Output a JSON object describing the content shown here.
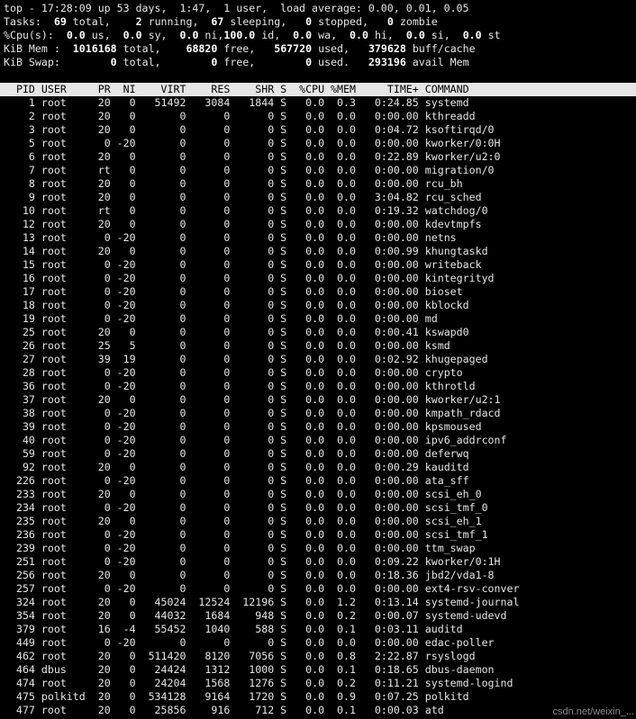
{
  "summary": {
    "top_line": "top - 17:28:09 up 53 days,  1:47,  1 user,  load average: 0.00, 0.01, 0.05",
    "tasks": {
      "prefix": "Tasks:",
      "total": "69",
      "total_l": " total,",
      "running": "2",
      "running_l": " running,",
      "sleeping": "67",
      "sleeping_l": " sleeping,",
      "stopped": "0",
      "stopped_l": " stopped,",
      "zombie": "0",
      "zombie_l": " zombie"
    },
    "cpu": {
      "prefix": "%Cpu(s):",
      "us": "0.0",
      "us_l": " us,",
      "sy": "0.0",
      "sy_l": " sy,",
      "ni": "0.0",
      "ni_l": " ni,",
      "id": "100.0",
      "id_l": " id,",
      "wa": "0.0",
      "wa_l": " wa,",
      "hi": "0.0",
      "hi_l": " hi,",
      "si": "0.0",
      "si_l": " si,",
      "st": "0.0",
      "st_l": " st"
    },
    "mem": {
      "prefix": "KiB Mem :",
      "total": "1016168",
      "total_l": " total,",
      "free": "68820",
      "free_l": " free,",
      "used": "567720",
      "used_l": " used,",
      "cache": "379628",
      "cache_l": " buff/cache"
    },
    "swap": {
      "prefix": "KiB Swap:",
      "total": "0",
      "total_l": " total,",
      "free": "0",
      "free_l": " free,",
      "used": "0",
      "used_l": " used.",
      "avail": "293196",
      "avail_l": " avail Mem"
    }
  },
  "columns": [
    "PID",
    "USER",
    "PR",
    "NI",
    "VIRT",
    "RES",
    "SHR",
    "S",
    "%CPU",
    "%MEM",
    "TIME+",
    "COMMAND"
  ],
  "processes": [
    [
      "1",
      "root",
      "20",
      "0",
      "51492",
      "3084",
      "1844",
      "S",
      "0.0",
      "0.3",
      "0:24.85",
      "systemd"
    ],
    [
      "2",
      "root",
      "20",
      "0",
      "0",
      "0",
      "0",
      "S",
      "0.0",
      "0.0",
      "0:00.00",
      "kthreadd"
    ],
    [
      "3",
      "root",
      "20",
      "0",
      "0",
      "0",
      "0",
      "S",
      "0.0",
      "0.0",
      "0:04.72",
      "ksoftirqd/0"
    ],
    [
      "5",
      "root",
      "0",
      "-20",
      "0",
      "0",
      "0",
      "S",
      "0.0",
      "0.0",
      "0:00.00",
      "kworker/0:0H"
    ],
    [
      "6",
      "root",
      "20",
      "0",
      "0",
      "0",
      "0",
      "S",
      "0.0",
      "0.0",
      "0:22.89",
      "kworker/u2:0"
    ],
    [
      "7",
      "root",
      "rt",
      "0",
      "0",
      "0",
      "0",
      "S",
      "0.0",
      "0.0",
      "0:00.00",
      "migration/0"
    ],
    [
      "8",
      "root",
      "20",
      "0",
      "0",
      "0",
      "0",
      "S",
      "0.0",
      "0.0",
      "0:00.00",
      "rcu_bh"
    ],
    [
      "9",
      "root",
      "20",
      "0",
      "0",
      "0",
      "0",
      "S",
      "0.0",
      "0.0",
      "3:04.82",
      "rcu_sched"
    ],
    [
      "10",
      "root",
      "rt",
      "0",
      "0",
      "0",
      "0",
      "S",
      "0.0",
      "0.0",
      "0:19.32",
      "watchdog/0"
    ],
    [
      "12",
      "root",
      "20",
      "0",
      "0",
      "0",
      "0",
      "S",
      "0.0",
      "0.0",
      "0:00.00",
      "kdevtmpfs"
    ],
    [
      "13",
      "root",
      "0",
      "-20",
      "0",
      "0",
      "0",
      "S",
      "0.0",
      "0.0",
      "0:00.00",
      "netns"
    ],
    [
      "14",
      "root",
      "20",
      "0",
      "0",
      "0",
      "0",
      "S",
      "0.0",
      "0.0",
      "0:00.99",
      "khungtaskd"
    ],
    [
      "15",
      "root",
      "0",
      "-20",
      "0",
      "0",
      "0",
      "S",
      "0.0",
      "0.0",
      "0:00.00",
      "writeback"
    ],
    [
      "16",
      "root",
      "0",
      "-20",
      "0",
      "0",
      "0",
      "S",
      "0.0",
      "0.0",
      "0:00.00",
      "kintegrityd"
    ],
    [
      "17",
      "root",
      "0",
      "-20",
      "0",
      "0",
      "0",
      "S",
      "0.0",
      "0.0",
      "0:00.00",
      "bioset"
    ],
    [
      "18",
      "root",
      "0",
      "-20",
      "0",
      "0",
      "0",
      "S",
      "0.0",
      "0.0",
      "0:00.00",
      "kblockd"
    ],
    [
      "19",
      "root",
      "0",
      "-20",
      "0",
      "0",
      "0",
      "S",
      "0.0",
      "0.0",
      "0:00.00",
      "md"
    ],
    [
      "25",
      "root",
      "20",
      "0",
      "0",
      "0",
      "0",
      "S",
      "0.0",
      "0.0",
      "0:00.41",
      "kswapd0"
    ],
    [
      "26",
      "root",
      "25",
      "5",
      "0",
      "0",
      "0",
      "S",
      "0.0",
      "0.0",
      "0:00.00",
      "ksmd"
    ],
    [
      "27",
      "root",
      "39",
      "19",
      "0",
      "0",
      "0",
      "S",
      "0.0",
      "0.0",
      "0:02.92",
      "khugepaged"
    ],
    [
      "28",
      "root",
      "0",
      "-20",
      "0",
      "0",
      "0",
      "S",
      "0.0",
      "0.0",
      "0:00.00",
      "crypto"
    ],
    [
      "36",
      "root",
      "0",
      "-20",
      "0",
      "0",
      "0",
      "S",
      "0.0",
      "0.0",
      "0:00.00",
      "kthrotld"
    ],
    [
      "37",
      "root",
      "20",
      "0",
      "0",
      "0",
      "0",
      "S",
      "0.0",
      "0.0",
      "0:00.00",
      "kworker/u2:1"
    ],
    [
      "38",
      "root",
      "0",
      "-20",
      "0",
      "0",
      "0",
      "S",
      "0.0",
      "0.0",
      "0:00.00",
      "kmpath_rdacd"
    ],
    [
      "39",
      "root",
      "0",
      "-20",
      "0",
      "0",
      "0",
      "S",
      "0.0",
      "0.0",
      "0:00.00",
      "kpsmoused"
    ],
    [
      "40",
      "root",
      "0",
      "-20",
      "0",
      "0",
      "0",
      "S",
      "0.0",
      "0.0",
      "0:00.00",
      "ipv6_addrconf"
    ],
    [
      "59",
      "root",
      "0",
      "-20",
      "0",
      "0",
      "0",
      "S",
      "0.0",
      "0.0",
      "0:00.00",
      "deferwq"
    ],
    [
      "92",
      "root",
      "20",
      "0",
      "0",
      "0",
      "0",
      "S",
      "0.0",
      "0.0",
      "0:00.29",
      "kauditd"
    ],
    [
      "226",
      "root",
      "0",
      "-20",
      "0",
      "0",
      "0",
      "S",
      "0.0",
      "0.0",
      "0:00.00",
      "ata_sff"
    ],
    [
      "233",
      "root",
      "20",
      "0",
      "0",
      "0",
      "0",
      "S",
      "0.0",
      "0.0",
      "0:00.00",
      "scsi_eh_0"
    ],
    [
      "234",
      "root",
      "0",
      "-20",
      "0",
      "0",
      "0",
      "S",
      "0.0",
      "0.0",
      "0:00.00",
      "scsi_tmf_0"
    ],
    [
      "235",
      "root",
      "20",
      "0",
      "0",
      "0",
      "0",
      "S",
      "0.0",
      "0.0",
      "0:00.00",
      "scsi_eh_1"
    ],
    [
      "236",
      "root",
      "0",
      "-20",
      "0",
      "0",
      "0",
      "S",
      "0.0",
      "0.0",
      "0:00.00",
      "scsi_tmf_1"
    ],
    [
      "239",
      "root",
      "0",
      "-20",
      "0",
      "0",
      "0",
      "S",
      "0.0",
      "0.0",
      "0:00.00",
      "ttm_swap"
    ],
    [
      "251",
      "root",
      "0",
      "-20",
      "0",
      "0",
      "0",
      "S",
      "0.0",
      "0.0",
      "0:09.22",
      "kworker/0:1H"
    ],
    [
      "256",
      "root",
      "20",
      "0",
      "0",
      "0",
      "0",
      "S",
      "0.0",
      "0.0",
      "0:18.36",
      "jbd2/vda1-8"
    ],
    [
      "257",
      "root",
      "0",
      "-20",
      "0",
      "0",
      "0",
      "S",
      "0.0",
      "0.0",
      "0:00.00",
      "ext4-rsv-conver"
    ],
    [
      "324",
      "root",
      "20",
      "0",
      "45024",
      "12524",
      "12196",
      "S",
      "0.0",
      "1.2",
      "0:13.14",
      "systemd-journal"
    ],
    [
      "354",
      "root",
      "20",
      "0",
      "44032",
      "1684",
      "948",
      "S",
      "0.0",
      "0.2",
      "0:00.07",
      "systemd-udevd"
    ],
    [
      "379",
      "root",
      "16",
      "-4",
      "55452",
      "1040",
      "588",
      "S",
      "0.0",
      "0.1",
      "0:03.11",
      "auditd"
    ],
    [
      "449",
      "root",
      "0",
      "-20",
      "0",
      "0",
      "0",
      "S",
      "0.0",
      "0.0",
      "0:00.00",
      "edac-poller"
    ],
    [
      "462",
      "root",
      "20",
      "0",
      "511420",
      "8120",
      "7056",
      "S",
      "0.0",
      "0.8",
      "2:22.87",
      "rsyslogd"
    ],
    [
      "464",
      "dbus",
      "20",
      "0",
      "24424",
      "1312",
      "1000",
      "S",
      "0.0",
      "0.1",
      "0:18.65",
      "dbus-daemon"
    ],
    [
      "474",
      "root",
      "20",
      "0",
      "24204",
      "1568",
      "1276",
      "S",
      "0.0",
      "0.2",
      "0:11.21",
      "systemd-logind"
    ],
    [
      "475",
      "polkitd",
      "20",
      "0",
      "534128",
      "9164",
      "1720",
      "S",
      "0.0",
      "0.9",
      "0:07.25",
      "polkitd"
    ],
    [
      "477",
      "root",
      "20",
      "0",
      "25856",
      "916",
      "712",
      "S",
      "0.0",
      "0.1",
      "0:00.03",
      "atd"
    ]
  ],
  "watermark": "csdn.net/weixin_..."
}
